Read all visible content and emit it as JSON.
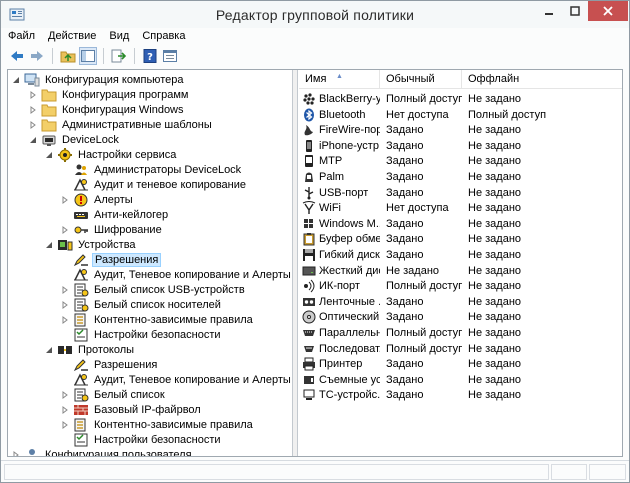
{
  "window": {
    "title": "Редактор групповой политики",
    "colors": {
      "close_button": "#c75050",
      "selection": "#cde8ff",
      "selection_border": "#99d1ff"
    }
  },
  "menubar": {
    "items": [
      {
        "label": "Файл"
      },
      {
        "label": "Действие"
      },
      {
        "label": "Вид"
      },
      {
        "label": "Справка"
      }
    ]
  },
  "toolbar": {
    "buttons": [
      "back-icon",
      "forward-icon",
      "up-folder-icon",
      "show-hide-tree-icon",
      "export-icon",
      "help-icon",
      "properties-icon"
    ]
  },
  "tree": {
    "items": [
      {
        "label": "Конфигурация компьютера",
        "icon": "computer-icon",
        "level": 0,
        "expander": "expanded"
      },
      {
        "label": "Конфигурация программ",
        "icon": "folder-icon",
        "level": 1,
        "expander": "collapsed"
      },
      {
        "label": "Конфигурация Windows",
        "icon": "folder-icon",
        "level": 1,
        "expander": "collapsed"
      },
      {
        "label": "Административные шаблоны",
        "icon": "folder-icon",
        "level": 1,
        "expander": "collapsed"
      },
      {
        "label": "DeviceLock",
        "icon": "lock-icon",
        "level": 1,
        "expander": "expanded"
      },
      {
        "label": "Настройки сервиса",
        "icon": "gear-icon",
        "level": 2,
        "expander": "expanded"
      },
      {
        "label": "Администраторы DeviceLock",
        "icon": "admins-icon",
        "level": 3,
        "expander": "none"
      },
      {
        "label": "Аудит и теневое копирование",
        "icon": "audit-icon",
        "level": 3,
        "expander": "none"
      },
      {
        "label": "Алерты",
        "icon": "alert-icon",
        "level": 3,
        "expander": "collapsed"
      },
      {
        "label": "Анти-кейлогер",
        "icon": "keylogger-icon",
        "level": 3,
        "expander": "none"
      },
      {
        "label": "Шифрование",
        "icon": "encryption-icon",
        "level": 3,
        "expander": "collapsed"
      },
      {
        "label": "Устройства",
        "icon": "devices-icon",
        "level": 2,
        "expander": "expanded"
      },
      {
        "label": "Разрешения",
        "icon": "permissions-icon",
        "level": 3,
        "expander": "none",
        "selected": true
      },
      {
        "label": "Аудит, Теневое копирование и Алерты",
        "icon": "audit-icon",
        "level": 3,
        "expander": "none"
      },
      {
        "label": "Белый список USB-устройств",
        "icon": "whitelist-icon",
        "level": 3,
        "expander": "collapsed"
      },
      {
        "label": "Белый список носителей",
        "icon": "whitelist-icon",
        "level": 3,
        "expander": "collapsed"
      },
      {
        "label": "Контентно-зависимые правила",
        "icon": "rules-icon",
        "level": 3,
        "expander": "collapsed"
      },
      {
        "label": "Настройки безопасности",
        "icon": "security-settings-icon",
        "level": 3,
        "expander": "none"
      },
      {
        "label": "Протоколы",
        "icon": "protocols-icon",
        "level": 2,
        "expander": "expanded"
      },
      {
        "label": "Разрешения",
        "icon": "permissions-icon",
        "level": 3,
        "expander": "none"
      },
      {
        "label": "Аудит, Теневое копирование и Алерты",
        "icon": "audit-icon",
        "level": 3,
        "expander": "none"
      },
      {
        "label": "Белый список",
        "icon": "whitelist-icon",
        "level": 3,
        "expander": "collapsed"
      },
      {
        "label": "Базовый IP-файрвол",
        "icon": "firewall-icon",
        "level": 3,
        "expander": "collapsed"
      },
      {
        "label": "Контентно-зависимые правила",
        "icon": "rules-icon",
        "level": 3,
        "expander": "collapsed"
      },
      {
        "label": "Настройки безопасности",
        "icon": "security-settings-icon",
        "level": 3,
        "expander": "none"
      },
      {
        "label": "Конфигурация пользователя",
        "icon": "user-icon",
        "level": 0,
        "expander": "collapsed"
      }
    ]
  },
  "list": {
    "columns": [
      "Имя",
      "Обычный",
      "Оффлайн"
    ],
    "rows": [
      {
        "name": "BlackBerry-у...",
        "icon": "blackberry-icon",
        "normal": "Полный доступ",
        "offline": "Не задано"
      },
      {
        "name": "Bluetooth",
        "icon": "bluetooth-icon",
        "normal": "Нет доступа",
        "offline": "Полный доступ"
      },
      {
        "name": "FireWire-порт",
        "icon": "firewire-icon",
        "normal": "Задано",
        "offline": "Не задано"
      },
      {
        "name": "iPhone-устр...",
        "icon": "iphone-icon",
        "normal": "Задано",
        "offline": "Не задано"
      },
      {
        "name": "MTP",
        "icon": "mtp-icon",
        "normal": "Задано",
        "offline": "Не задано"
      },
      {
        "name": "Palm",
        "icon": "palm-icon",
        "normal": "Задано",
        "offline": "Не задано"
      },
      {
        "name": "USB-порт",
        "icon": "usb-icon",
        "normal": "Задано",
        "offline": "Не задано"
      },
      {
        "name": "WiFi",
        "icon": "wifi-icon",
        "normal": "Нет доступа",
        "offline": "Не задано"
      },
      {
        "name": "Windows M...",
        "icon": "windows-mobile-icon",
        "normal": "Задано",
        "offline": "Не задано"
      },
      {
        "name": "Буфер обме...",
        "icon": "clipboard-icon",
        "normal": "Задано",
        "offline": "Не задано"
      },
      {
        "name": "Гибкий диск",
        "icon": "floppy-icon",
        "normal": "Задано",
        "offline": "Не задано"
      },
      {
        "name": "Жесткий диск",
        "icon": "hard-drive-icon",
        "normal": "Не задано",
        "offline": "Не задано"
      },
      {
        "name": "ИК-порт",
        "icon": "infrared-icon",
        "normal": "Полный доступ",
        "offline": "Не задано"
      },
      {
        "name": "Ленточные ...",
        "icon": "tape-icon",
        "normal": "Задано",
        "offline": "Не задано"
      },
      {
        "name": "Оптический...",
        "icon": "optical-drive-icon",
        "normal": "Задано",
        "offline": "Не задано"
      },
      {
        "name": "Параллельн...",
        "icon": "parallel-port-icon",
        "normal": "Полный доступ",
        "offline": "Не задано"
      },
      {
        "name": "Последоват...",
        "icon": "serial-port-icon",
        "normal": "Полный доступ",
        "offline": "Не задано"
      },
      {
        "name": "Принтер",
        "icon": "printer-icon",
        "normal": "Задано",
        "offline": "Не задано"
      },
      {
        "name": "Съемные ус...",
        "icon": "removable-icon",
        "normal": "Задано",
        "offline": "Не задано"
      },
      {
        "name": "TC-устройс...",
        "icon": "tc-device-icon",
        "normal": "Задано",
        "offline": "Не задано"
      }
    ]
  }
}
